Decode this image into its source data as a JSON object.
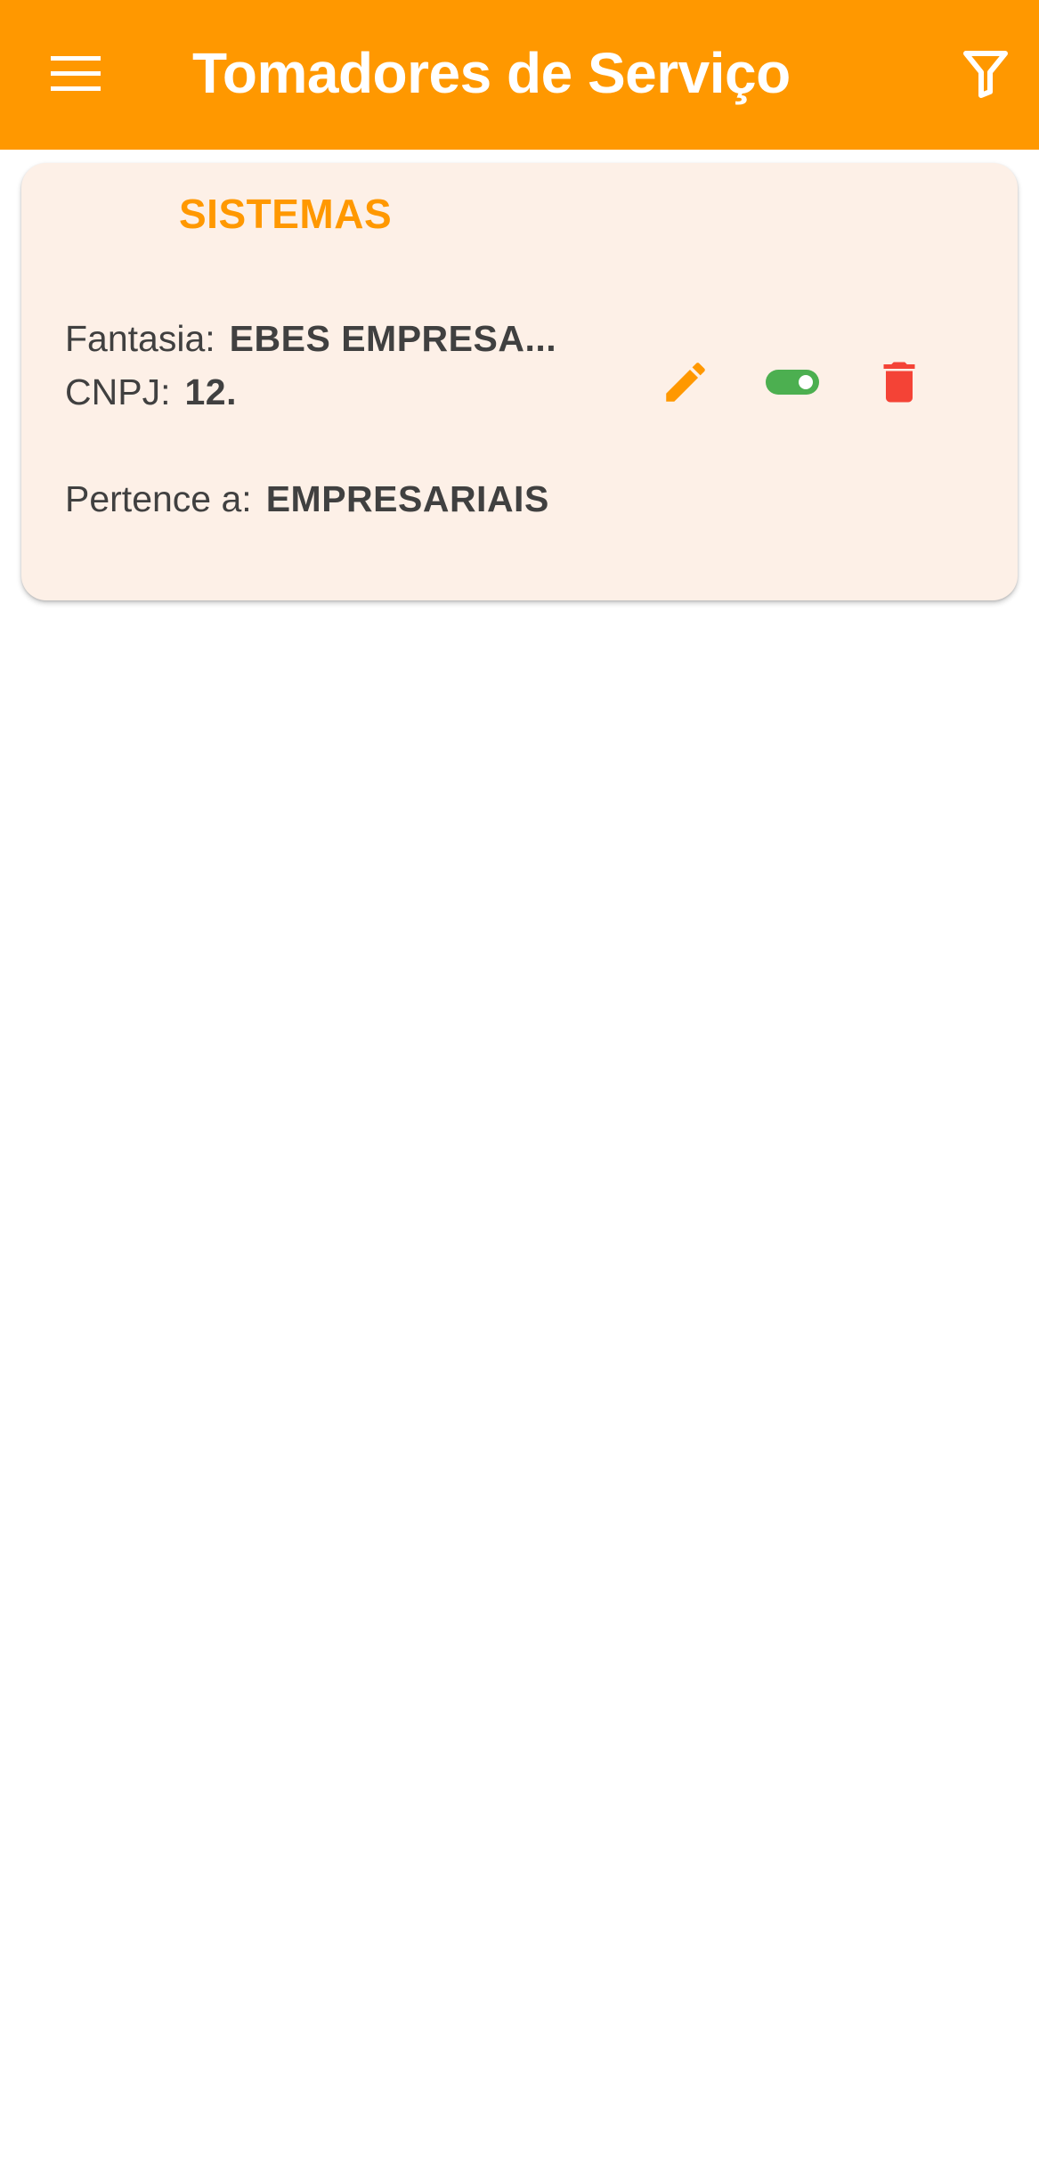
{
  "app_bar": {
    "title": "Tomadores de Serviço",
    "menu_icon": "menu-icon",
    "filter_icon": "filter-icon",
    "background_color": "#ff9800"
  },
  "cards": [
    {
      "title": "SISTEMAS",
      "fantasia_label": "Fantasia:",
      "fantasia_value": "EBES EMPRESA...",
      "cnpj_label": "CNPJ:",
      "cnpj_value": "12.",
      "pertence_label": "Pertence a:",
      "pertence_value": "EMPRESARIAIS",
      "actions": {
        "edit_icon": "pencil-icon",
        "toggle_icon": "toggle-on-icon",
        "toggle_active": true,
        "delete_icon": "trash-icon"
      },
      "colors": {
        "background": "#fdf0e7",
        "title": "#ff9800",
        "edit": "#ff9800",
        "toggle": "#4caf50",
        "delete": "#f44336"
      }
    }
  ]
}
